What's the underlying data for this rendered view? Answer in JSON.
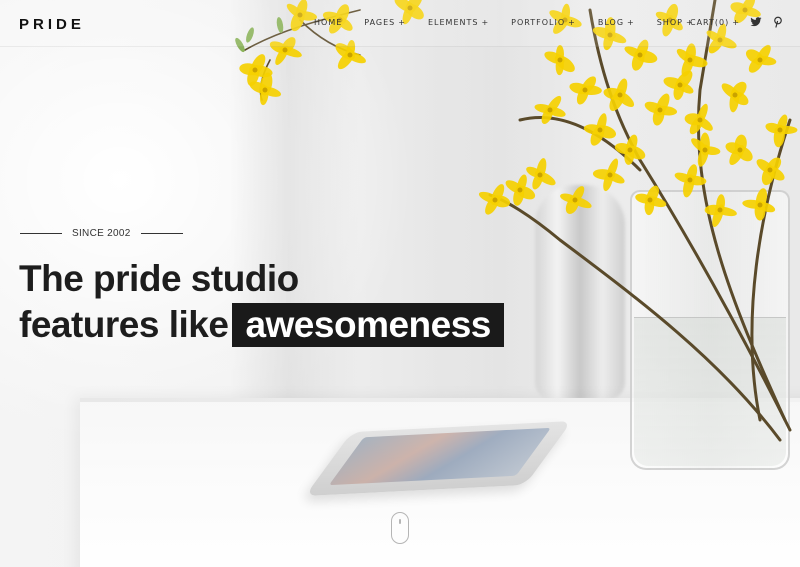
{
  "brand": {
    "logo_text": "PRIDE"
  },
  "nav": {
    "items": [
      {
        "label": "HOME",
        "has_submenu": false
      },
      {
        "label": "PAGES",
        "has_submenu": true
      },
      {
        "label": "ELEMENTS",
        "has_submenu": true
      },
      {
        "label": "PORTFOLIO",
        "has_submenu": true
      },
      {
        "label": "BLOG",
        "has_submenu": true
      },
      {
        "label": "SHOP",
        "has_submenu": true
      }
    ],
    "submenu_symbol": "+",
    "cart_label": "CART(0)",
    "social_icons": [
      "twitter-icon",
      "pinterest-icon"
    ]
  },
  "hero": {
    "since_label": "SINCE 2002",
    "headline_line1": "The pride studio",
    "headline_line2_prefix": "features like",
    "headline_highlight": "awesomeness"
  },
  "colors": {
    "text_dark": "#1d1d1d",
    "highlight_bg": "#1a1a1a",
    "highlight_text": "#ffffff",
    "flower_yellow": "#f5d000",
    "stem_brown": "#5a4a2a"
  }
}
